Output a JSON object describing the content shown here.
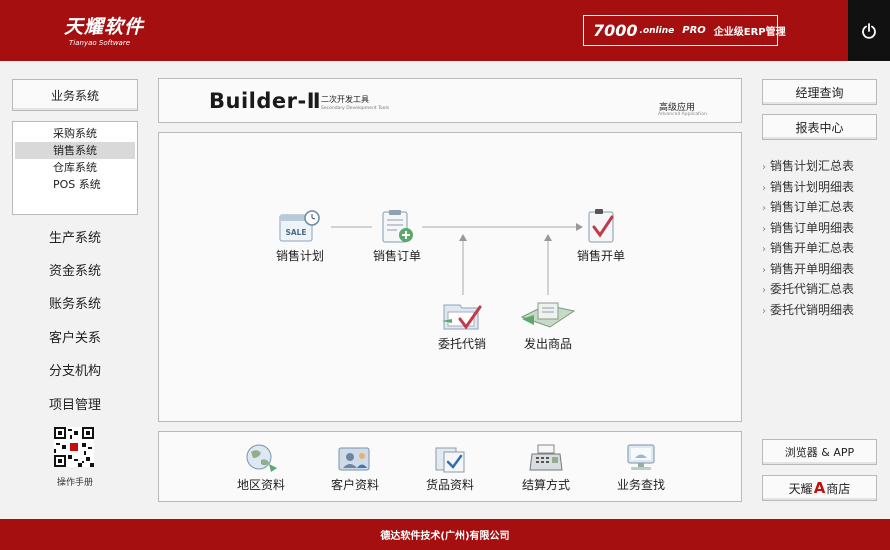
{
  "header": {
    "logo_main": "天耀软件",
    "logo_sub": "Tianyao Software",
    "brand_number": "7000",
    "brand_online": ".online",
    "brand_pro": "PRO",
    "brand_erp": "企业级ERP管理",
    "power_icon": "power-icon"
  },
  "left": {
    "business_button": "业务系统",
    "subsystems": [
      {
        "label": "采购系统",
        "active": false
      },
      {
        "label": "销售系统",
        "active": true
      },
      {
        "label": "仓库系统",
        "active": false
      },
      {
        "label": "POS 系统",
        "active": false
      }
    ],
    "nav": [
      "生产系统",
      "资金系统",
      "账务系统",
      "客户关系",
      "分支机构",
      "项目管理"
    ],
    "manual_label": "操作手册"
  },
  "builder": {
    "title": "Builder-Ⅱ",
    "sub_cn": "二次开发工具",
    "sub_en": "Secondary Development Tools",
    "adv_cn": "高级应用",
    "adv_en": "Advanced Application"
  },
  "flow": {
    "plan": "销售计划",
    "order": "销售订单",
    "invoice": "销售开单",
    "consign": "委托代销",
    "ship": "发出商品",
    "plan_icon_text": "SALE"
  },
  "bottom": [
    "地区资料",
    "客户资料",
    "货品资料",
    "结算方式",
    "业务查找"
  ],
  "right": {
    "manager_query": "经理查询",
    "report_center": "报表中心",
    "reports": [
      "销售计划汇总表",
      "销售计划明细表",
      "销售订单汇总表",
      "销售订单明细表",
      "销售开单汇总表",
      "销售开单明细表",
      "委托代销汇总表",
      "委托代销明细表"
    ],
    "browser_app": "浏览器 & APP",
    "store_prefix": "天耀",
    "store_a": "A",
    "store_suffix": "商店"
  },
  "footer": "德达软件技术(广州)有限公司",
  "colors": {
    "brand_red": "#a50f0f",
    "power_bg": "#111111",
    "active_bg": "#d9d9d9"
  }
}
